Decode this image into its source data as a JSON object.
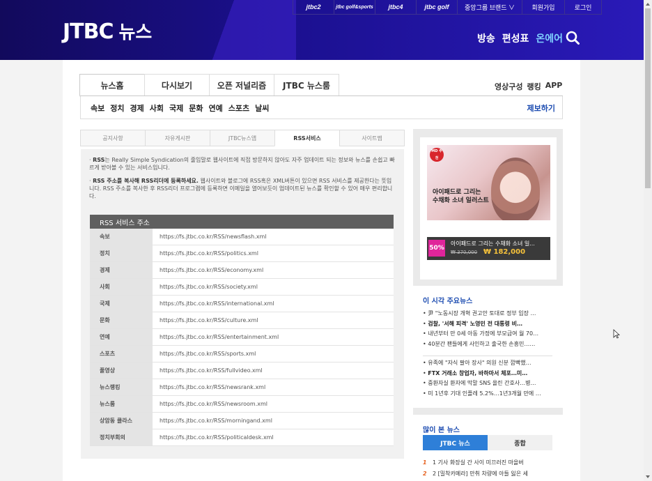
{
  "header": {
    "logo": "JTBC",
    "logo_suffix": "뉴스",
    "top_links": [
      "jtbc2",
      "jtbc golf&sports",
      "jtbc4",
      "jtbc golf",
      "중앙그룹 브랜드 ∨",
      "회원가입",
      "로그인"
    ],
    "main_nav": [
      "방송",
      "편성표",
      "온에어"
    ]
  },
  "tabs": [
    "뉴스홈",
    "다시보기",
    "오픈 저널리즘",
    "JTBC 뉴스룸"
  ],
  "right_links": [
    "영상구성",
    "랭킹",
    "APP"
  ],
  "subnav": [
    "속보",
    "정치",
    "경제",
    "사회",
    "국제",
    "문화",
    "연예",
    "스포츠",
    "날씨"
  ],
  "report": "제보하기",
  "subtabs": [
    "공지사항",
    "자유게시판",
    "JTBC뉴스앱",
    "RSS서비스",
    "사이트맵"
  ],
  "desc": {
    "p1_bold": "RSS",
    "p1": "는 Really Simple Syndication의 줄임말로 웹사이트에 직접 방문하지 않아도 자주 업데이트 되는 정보와 뉴스를 손쉽고 빠르게 받아볼 수 있는 서비스입니다.",
    "p2_bold": "RSS 주소를 복사해 RSS리더에 등록하세요.",
    "p2": " 웹사이트와 블로그에 RSS혹은 XML버튼이 있으면 RSS 서비스를 제공한다는 뜻입니다. RSS 주소를 복사한 후 RSS리더 프로그램에 등록하면 이메일을 열어보듯이 업데이트된 뉴스를 확인할 수 있어 매우 편리합니다."
  },
  "rss_title": "RSS 서비스 주소",
  "rss": [
    {
      "cat": "속보",
      "url": "https://fs.jtbc.co.kr/RSS/newsflash.xml"
    },
    {
      "cat": "정치",
      "url": "https://fs.jtbc.co.kr/RSS/politics.xml"
    },
    {
      "cat": "경제",
      "url": "https://fs.jtbc.co.kr/RSS/economy.xml"
    },
    {
      "cat": "사회",
      "url": "https://fs.jtbc.co.kr/RSS/society.xml"
    },
    {
      "cat": "국제",
      "url": "https://fs.jtbc.co.kr/RSS/international.xml"
    },
    {
      "cat": "문화",
      "url": "https://fs.jtbc.co.kr/RSS/culture.xml"
    },
    {
      "cat": "연예",
      "url": "https://fs.jtbc.co.kr/RSS/entertainment.xml"
    },
    {
      "cat": "스포츠",
      "url": "https://fs.jtbc.co.kr/RSS/sports.xml"
    },
    {
      "cat": "풀영상",
      "url": "https://fs.jtbc.co.kr/RSS/fullvideo.xml"
    },
    {
      "cat": "뉴스랭킹",
      "url": "https://fs.jtbc.co.kr/RSS/newsrank.xml"
    },
    {
      "cat": "뉴스룸",
      "url": "https://fs.jtbc.co.kr/RSS/newsroom.xml"
    },
    {
      "cat": "상암동 클라스",
      "url": "https://fs.jtbc.co.kr/RSS/morningand.xml"
    },
    {
      "cat": "정치부회의",
      "url": "https://fs.jtbc.co.kr/RSS/politicaldesk.xml"
    }
  ],
  "ad": {
    "badge": "MD 추천",
    "line1": "아이패드로 그리는",
    "line2": "수채화 소녀 일러스트",
    "discount": "50%",
    "name": "아이패드로 그리는 수채화 소녀 일...",
    "old_price": "₩ 370,000",
    "new_price": "₩ 182,000"
  },
  "news1": {
    "title": "이 시각 주요뉴스",
    "group1": [
      "尹 \"노동시장 개혁 권고안 토대로 정부 입장 …",
      "검찰, '서해 피격' 노영민 전 대통령 비…",
      "내년부터 만 0세 아동 가정에 부모급여 월 70…",
      "40분간 팬들에게 사인하고 출국한 손흥민……"
    ],
    "group2": [
      "유족에 \"자식 팔아 장사\" 의원 신분 깜빡했…",
      "FTX 거래소 창업자, 바하마서 체포…미…",
      "중환자실 환자에 막말 SNS 올린 간호사…병…",
      "미 1년후 기대 인플레 5.2%…1년3개월 만에 …"
    ]
  },
  "news2": {
    "title": "많이 본 뉴스",
    "tabs": [
      "JTBC 뉴스",
      "종합"
    ],
    "rank": [
      {
        "n": "1",
        "t": "1  기사 화장실 간 사이 미끄러진 마을버"
      },
      {
        "n": "2",
        "t": "2  [밀착카메라] 만취 차량에 아들 잃은 세"
      }
    ]
  }
}
